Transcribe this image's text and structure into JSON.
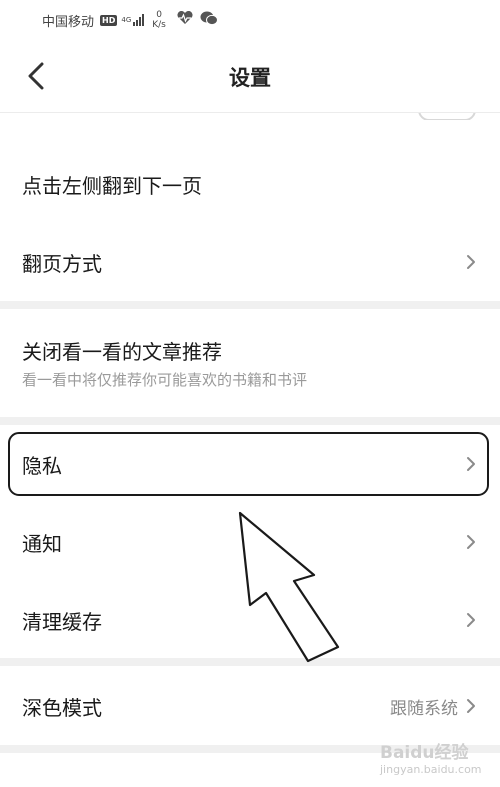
{
  "status_bar": {
    "carrier": "中国移动",
    "hd": "HD",
    "network": "4G",
    "speed_value": "0",
    "speed_unit": "K/s"
  },
  "nav": {
    "title": "设置"
  },
  "rows": {
    "tap_left": {
      "label": "点击左侧翻到下一页"
    },
    "page_turn": {
      "label": "翻页方式"
    },
    "article_rec": {
      "label": "关闭看一看的文章推荐",
      "sub": "看一看中将仅推荐你可能喜欢的书籍和书评"
    },
    "privacy": {
      "label": "隐私"
    },
    "notify": {
      "label": "通知"
    },
    "clear_cache": {
      "label": "清理缓存"
    },
    "dark_mode": {
      "label": "深色模式",
      "value": "跟随系统"
    }
  },
  "watermark": {
    "main": "Baidu经验",
    "url": "jingyan.baidu.com"
  },
  "colors": {
    "text": "#1a1a1a",
    "secondary": "#9a9a9a",
    "gap": "#f0f0f0",
    "chevron": "#8a8a8a"
  }
}
